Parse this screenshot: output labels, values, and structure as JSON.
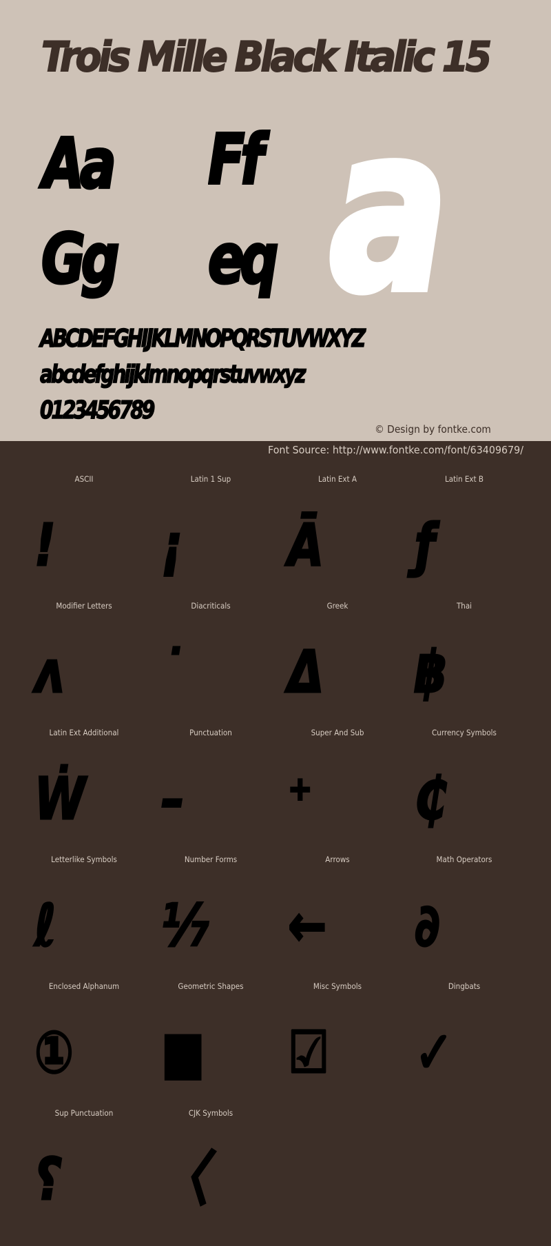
{
  "header": {
    "title": "Trois Mille Black Italic 15",
    "preview_pairs": [
      "Aa",
      "Ff",
      "Gg",
      "eq"
    ],
    "hero_glyph": "a",
    "uppercase": "ABCDEFGHIJKLMNOPQRSTUVWXYZ",
    "lowercase": "abcdefghijklmnopqrstuvwxyz",
    "digits": "0123456789",
    "credit": "© Design by fontke.com"
  },
  "source": {
    "text": "Font Source: http://www.fontke.com/font/63409679/"
  },
  "colors": {
    "top_background": "#cec2b7",
    "bottom_background": "#3d2f28",
    "title_color": "#3d2f28",
    "glyph_color": "#000000",
    "hero_glyph_color": "#ffffff",
    "label_color": "#d8cdc3"
  },
  "blocks": [
    {
      "label": "ASCII",
      "glyph": "!"
    },
    {
      "label": "Latin 1 Sup",
      "glyph": "¡"
    },
    {
      "label": "Latin Ext A",
      "glyph": "Ā"
    },
    {
      "label": "Latin Ext B",
      "glyph": "ƒ"
    },
    {
      "label": "Modifier Letters",
      "glyph": "ʌ"
    },
    {
      "label": "Diacriticals",
      "glyph": "˙"
    },
    {
      "label": "Greek",
      "glyph": "Δ"
    },
    {
      "label": "Thai",
      "glyph": "฿"
    },
    {
      "label": "Latin Ext Additional",
      "glyph": "Ẇ"
    },
    {
      "label": "Punctuation",
      "glyph": "–"
    },
    {
      "label": "Super And Sub",
      "glyph": "⁺"
    },
    {
      "label": "Currency Symbols",
      "glyph": "₵"
    },
    {
      "label": "Letterlike Symbols",
      "glyph": "ℓ"
    },
    {
      "label": "Number Forms",
      "glyph": "⅐"
    },
    {
      "label": "Arrows",
      "glyph": "←"
    },
    {
      "label": "Math Operators",
      "glyph": "∂"
    },
    {
      "label": "Enclosed Alphanum",
      "glyph": "①"
    },
    {
      "label": "Geometric Shapes",
      "glyph": "■"
    },
    {
      "label": "Misc Symbols",
      "glyph": "☑"
    },
    {
      "label": "Dingbats",
      "glyph": "✓"
    },
    {
      "label": "Sup Punctuation",
      "glyph": "⸮"
    },
    {
      "label": "CJK Symbols",
      "glyph": "〈"
    }
  ]
}
